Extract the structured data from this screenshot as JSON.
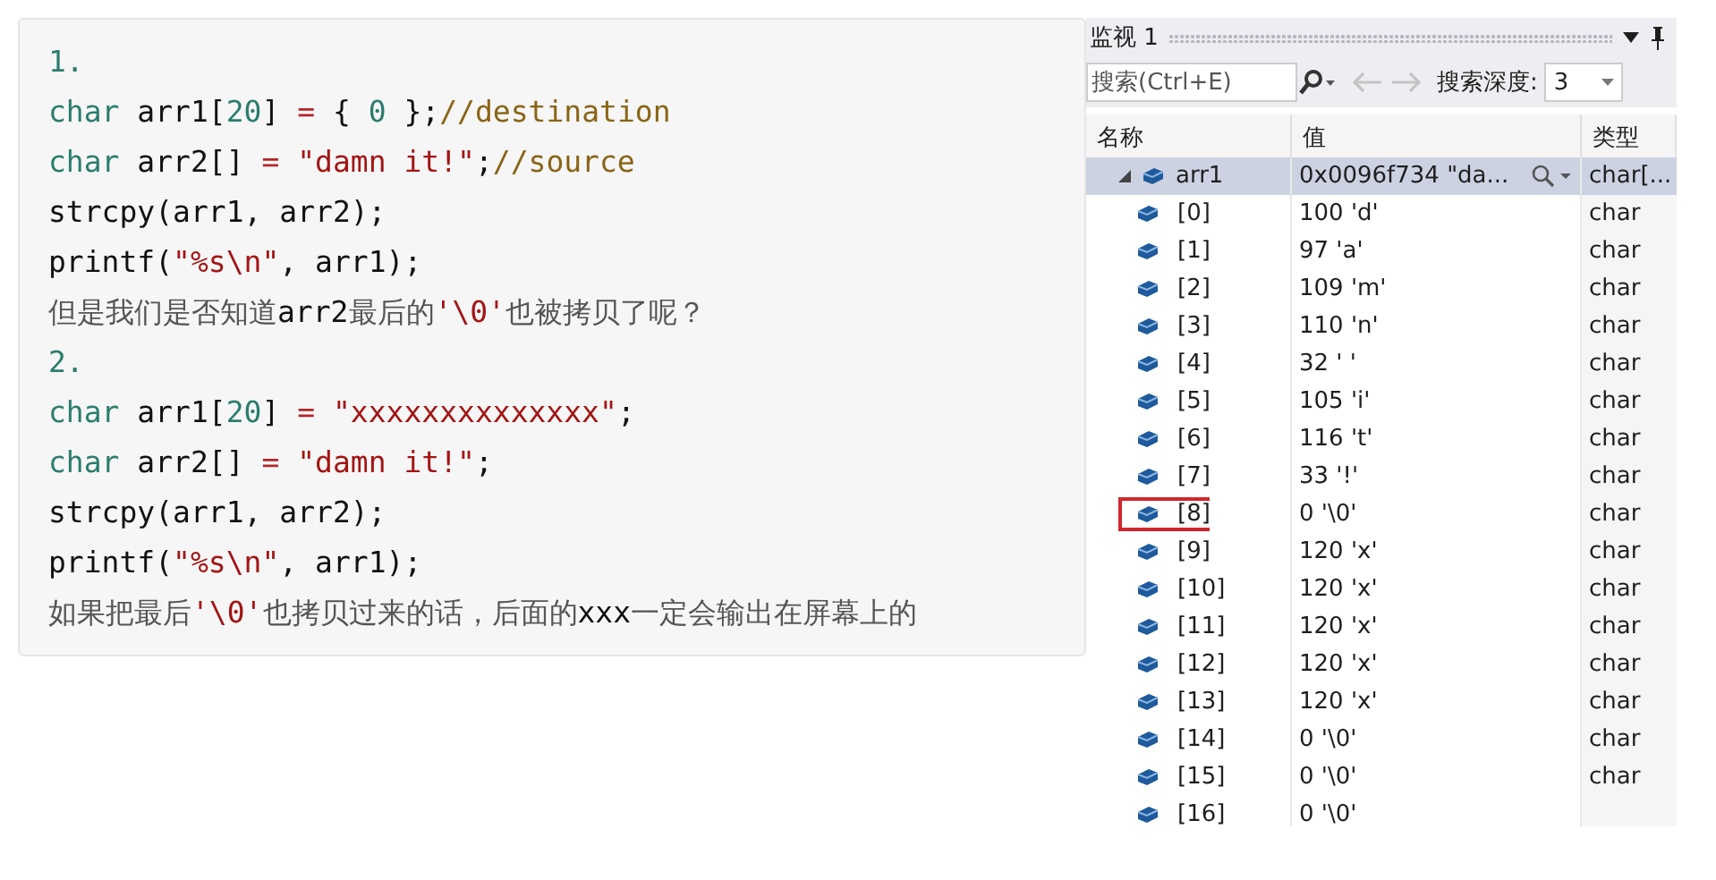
{
  "code_card": {
    "lines": [
      {
        "tokens": [
          {
            "kind": "num",
            "text": "1."
          }
        ]
      },
      {
        "tokens": [
          {
            "kind": "kw",
            "text": "char"
          },
          {
            "kind": "plain",
            "text": " arr1["
          },
          {
            "kind": "num",
            "text": "20"
          },
          {
            "kind": "plain",
            "text": "] "
          },
          {
            "kind": "op",
            "text": "="
          },
          {
            "kind": "plain",
            "text": " { "
          },
          {
            "kind": "num",
            "text": "0"
          },
          {
            "kind": "plain",
            "text": " };"
          },
          {
            "kind": "comment",
            "text": "//destination"
          }
        ]
      },
      {
        "tokens": [
          {
            "kind": "kw",
            "text": "char"
          },
          {
            "kind": "plain",
            "text": " arr2[] "
          },
          {
            "kind": "op",
            "text": "="
          },
          {
            "kind": "str",
            "text": " \"damn it!\""
          },
          {
            "kind": "plain",
            "text": ";"
          },
          {
            "kind": "comment",
            "text": "//source"
          }
        ]
      },
      {
        "tokens": [
          {
            "kind": "plain",
            "text": "strcpy(arr1, arr2);"
          }
        ]
      },
      {
        "tokens": [
          {
            "kind": "plain",
            "text": "printf("
          },
          {
            "kind": "str",
            "text": "\"%s\\n\""
          },
          {
            "kind": "plain",
            "text": ", arr1);"
          }
        ]
      },
      {
        "tokens": [
          {
            "kind": "cjk",
            "text": "但是我们是否知道"
          },
          {
            "kind": "plain",
            "text": "arr2"
          },
          {
            "kind": "cjk",
            "text": "最后的"
          },
          {
            "kind": "str",
            "text": "'\\0'"
          },
          {
            "kind": "cjk",
            "text": "也被拷贝了呢？"
          }
        ]
      },
      {
        "tokens": [
          {
            "kind": "num",
            "text": "2."
          }
        ]
      },
      {
        "tokens": [
          {
            "kind": "kw",
            "text": "char"
          },
          {
            "kind": "plain",
            "text": " arr1["
          },
          {
            "kind": "num",
            "text": "20"
          },
          {
            "kind": "plain",
            "text": "] "
          },
          {
            "kind": "op",
            "text": "="
          },
          {
            "kind": "str",
            "text": " \"xxxxxxxxxxxxxx\""
          },
          {
            "kind": "plain",
            "text": ";"
          }
        ]
      },
      {
        "tokens": [
          {
            "kind": "kw",
            "text": "char"
          },
          {
            "kind": "plain",
            "text": " arr2[] "
          },
          {
            "kind": "op",
            "text": "="
          },
          {
            "kind": "str",
            "text": " \"damn it!\""
          },
          {
            "kind": "plain",
            "text": ";"
          }
        ]
      },
      {
        "tokens": [
          {
            "kind": "plain",
            "text": "strcpy(arr1, arr2);"
          }
        ]
      },
      {
        "tokens": [
          {
            "kind": "plain",
            "text": "printf("
          },
          {
            "kind": "str",
            "text": "\"%s\\n\""
          },
          {
            "kind": "plain",
            "text": ", arr1);"
          }
        ]
      },
      {
        "tokens": [
          {
            "kind": "cjk",
            "text": "如果把最后"
          },
          {
            "kind": "str",
            "text": "'\\0'"
          },
          {
            "kind": "cjk",
            "text": "也拷贝过来的话，后面的"
          },
          {
            "kind": "plain",
            "text": "xxx"
          },
          {
            "kind": "cjk",
            "text": "一定会输出在屏幕上的"
          }
        ]
      }
    ]
  },
  "watch_window": {
    "title": "监视 1",
    "search": {
      "placeholder": "搜索(Ctrl+E)"
    },
    "depth_label": "搜索深度:",
    "depth_value": "3",
    "columns": [
      "名称",
      "值",
      "类型"
    ],
    "root": {
      "name": "arr1",
      "value": "0x0096f734 \"da...",
      "type": "char[...",
      "expanded": true,
      "selected": true,
      "children": [
        {
          "name": "[0]",
          "value": "100 'd'",
          "type": "char",
          "marked": false
        },
        {
          "name": "[1]",
          "value": "97 'a'",
          "type": "char",
          "marked": false
        },
        {
          "name": "[2]",
          "value": "109 'm'",
          "type": "char",
          "marked": false
        },
        {
          "name": "[3]",
          "value": "110 'n'",
          "type": "char",
          "marked": false
        },
        {
          "name": "[4]",
          "value": "32 ' '",
          "type": "char",
          "marked": false
        },
        {
          "name": "[5]",
          "value": "105 'i'",
          "type": "char",
          "marked": false
        },
        {
          "name": "[6]",
          "value": "116 't'",
          "type": "char",
          "marked": false
        },
        {
          "name": "[7]",
          "value": "33 '!'",
          "type": "char",
          "marked": false
        },
        {
          "name": "[8]",
          "value": "0 '\\0'",
          "type": "char",
          "marked": true
        },
        {
          "name": "[9]",
          "value": "120 'x'",
          "type": "char",
          "marked": false
        },
        {
          "name": "[10]",
          "value": "120 'x'",
          "type": "char",
          "marked": false
        },
        {
          "name": "[11]",
          "value": "120 'x'",
          "type": "char",
          "marked": false
        },
        {
          "name": "[12]",
          "value": "120 'x'",
          "type": "char",
          "marked": false
        },
        {
          "name": "[13]",
          "value": "120 'x'",
          "type": "char",
          "marked": false
        },
        {
          "name": "[14]",
          "value": "0 '\\0'",
          "type": "char",
          "marked": false
        },
        {
          "name": "[15]",
          "value": "0 '\\0'",
          "type": "char",
          "marked": false
        },
        {
          "name": "[16]",
          "value": "0 '\\0'",
          "marked": false
        }
      ]
    }
  }
}
